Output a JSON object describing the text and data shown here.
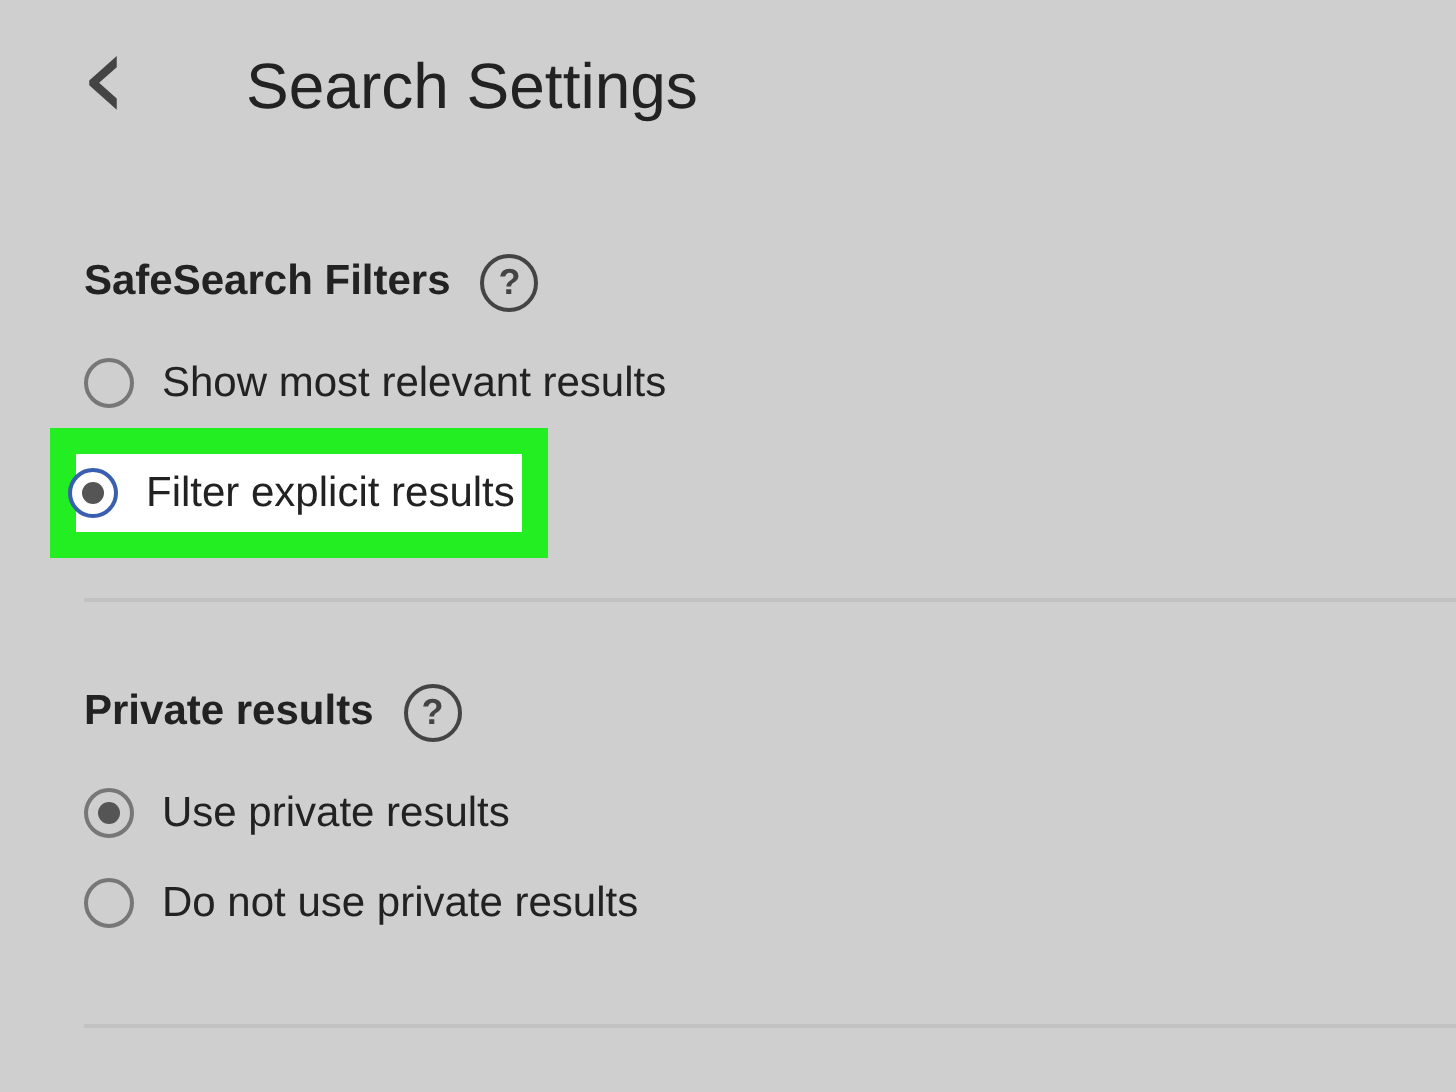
{
  "header": {
    "back": "‹",
    "title": "Search Settings"
  },
  "sections": [
    {
      "title": "SafeSearch Filters",
      "help": "?",
      "options": [
        {
          "label": "Show most relevant results",
          "selected": false,
          "highlighted": false
        },
        {
          "label": "Filter explicit results",
          "selected": true,
          "highlighted": true
        }
      ]
    },
    {
      "title": "Private results",
      "help": "?",
      "options": [
        {
          "label": "Use private results",
          "selected": true,
          "highlighted": false
        },
        {
          "label": "Do not use private results",
          "selected": false,
          "highlighted": false
        }
      ]
    }
  ]
}
